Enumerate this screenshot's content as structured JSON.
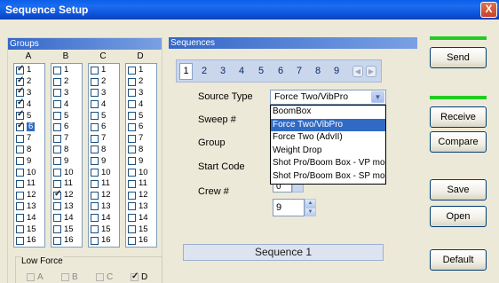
{
  "window": {
    "title": "Sequence Setup",
    "close_symbol": "X"
  },
  "groups": {
    "header": "Groups",
    "columns": [
      {
        "label": "A",
        "rows": [
          {
            "n": "1",
            "checked": true
          },
          {
            "n": "2",
            "checked": true
          },
          {
            "n": "3",
            "checked": true
          },
          {
            "n": "4",
            "checked": true
          },
          {
            "n": "5",
            "checked": true
          },
          {
            "n": "6",
            "checked": true,
            "selected": true
          },
          {
            "n": "7",
            "checked": false
          },
          {
            "n": "8",
            "checked": false
          },
          {
            "n": "9",
            "checked": false
          },
          {
            "n": "10",
            "checked": false
          },
          {
            "n": "11",
            "checked": false
          },
          {
            "n": "12",
            "checked": false
          },
          {
            "n": "13",
            "checked": false
          },
          {
            "n": "14",
            "checked": false
          },
          {
            "n": "15",
            "checked": false
          },
          {
            "n": "16",
            "checked": false
          }
        ]
      },
      {
        "label": "B",
        "rows": [
          {
            "n": "1",
            "checked": false
          },
          {
            "n": "2",
            "checked": false
          },
          {
            "n": "3",
            "checked": false
          },
          {
            "n": "4",
            "checked": false
          },
          {
            "n": "5",
            "checked": false
          },
          {
            "n": "6",
            "checked": false
          },
          {
            "n": "7",
            "checked": false
          },
          {
            "n": "8",
            "checked": false
          },
          {
            "n": "9",
            "checked": false
          },
          {
            "n": "10",
            "checked": false
          },
          {
            "n": "11",
            "checked": false
          },
          {
            "n": "12",
            "checked": true
          },
          {
            "n": "13",
            "checked": false
          },
          {
            "n": "14",
            "checked": false
          },
          {
            "n": "15",
            "checked": false
          },
          {
            "n": "16",
            "checked": false
          }
        ]
      },
      {
        "label": "C",
        "rows": [
          {
            "n": "1",
            "checked": false
          },
          {
            "n": "2",
            "checked": false
          },
          {
            "n": "3",
            "checked": false
          },
          {
            "n": "4",
            "checked": false
          },
          {
            "n": "5",
            "checked": false
          },
          {
            "n": "6",
            "checked": false
          },
          {
            "n": "7",
            "checked": false
          },
          {
            "n": "8",
            "checked": false
          },
          {
            "n": "9",
            "checked": false
          },
          {
            "n": "10",
            "checked": false
          },
          {
            "n": "11",
            "checked": false
          },
          {
            "n": "12",
            "checked": false
          },
          {
            "n": "13",
            "checked": false
          },
          {
            "n": "14",
            "checked": false
          },
          {
            "n": "15",
            "checked": false
          },
          {
            "n": "16",
            "checked": false
          }
        ]
      },
      {
        "label": "D",
        "rows": [
          {
            "n": "1",
            "checked": false
          },
          {
            "n": "2",
            "checked": false
          },
          {
            "n": "3",
            "checked": false
          },
          {
            "n": "4",
            "checked": false
          },
          {
            "n": "5",
            "checked": false
          },
          {
            "n": "6",
            "checked": false
          },
          {
            "n": "7",
            "checked": false
          },
          {
            "n": "8",
            "checked": false
          },
          {
            "n": "9",
            "checked": false
          },
          {
            "n": "10",
            "checked": false
          },
          {
            "n": "11",
            "checked": false
          },
          {
            "n": "12",
            "checked": false
          },
          {
            "n": "13",
            "checked": false
          },
          {
            "n": "14",
            "checked": false
          },
          {
            "n": "15",
            "checked": false
          },
          {
            "n": "16",
            "checked": false
          }
        ]
      }
    ],
    "low_force": {
      "title": "Low Force",
      "items": [
        {
          "label": "A",
          "checked": false
        },
        {
          "label": "B",
          "checked": false
        },
        {
          "label": "C",
          "checked": false
        },
        {
          "label": "D",
          "checked": true
        }
      ]
    }
  },
  "sequences": {
    "header": "Sequences",
    "tabs": [
      "1",
      "2",
      "3",
      "4",
      "5",
      "6",
      "7",
      "8",
      "9"
    ],
    "active_tab": "1",
    "source_type": {
      "label": "Source Type",
      "value": "Force Two/VibPro",
      "options": [
        "BoomBox",
        "Force Two/VibPro",
        "Force Two (AdvII)",
        "Weight Drop",
        "Shot Pro/Boom Box - VP mod",
        "Shot Pro/Boom Box - SP mod"
      ],
      "highlighted": "Force Two/VibPro"
    },
    "sweep_label": "Sweep #",
    "group_label": "Group",
    "start_code": {
      "label": "Start Code",
      "value": "0"
    },
    "crew": {
      "label": "Crew #",
      "value": "9"
    },
    "status": "Sequence 1"
  },
  "buttons": {
    "send": "Send",
    "receive": "Receive",
    "compare": "Compare",
    "save": "Save",
    "open": "Open",
    "default": "Default"
  },
  "colors": {
    "indicator": "#22cc22",
    "title_bar": "#0a5ee8",
    "selection": "#316ac5"
  },
  "icons": [
    "close-icon",
    "checkbox-icon",
    "dropdown-arrow-icon",
    "spinner-up-icon",
    "spinner-down-icon",
    "prev-arrow-icon",
    "next-arrow-icon"
  ]
}
